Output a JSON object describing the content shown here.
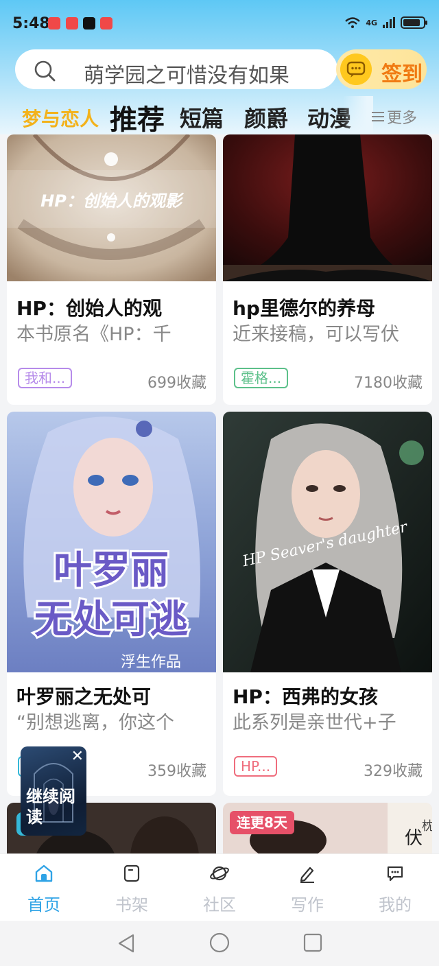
{
  "status": {
    "time": "5:48",
    "network": "4G"
  },
  "search": {
    "text": "萌学园之可惜没有如果"
  },
  "signin": {
    "label": "签到"
  },
  "tabs": [
    "梦与恋人",
    "推荐",
    "短篇",
    "颜爵",
    "动漫"
  ],
  "more_label": "更多",
  "cards": [
    {
      "cover_text": "HP：创始人的观影",
      "title": "HP：创始人的观",
      "desc": "本书原名《HP：千",
      "tag": "我和...",
      "tag_color": "#b68bea",
      "count": "699收藏"
    },
    {
      "title": "hp里德尔的养母",
      "desc": "近来接稿，可以写伏",
      "tag": "霍格...",
      "tag_color": "#5cc08a",
      "count": "7180收藏"
    },
    {
      "cover_text_line1": "叶罗丽",
      "cover_text_line2": "无处可逃",
      "cover_signature": "浮生作品",
      "title": "叶罗丽之无处可",
      "desc": "“别想逃离，你这个",
      "tag": "",
      "tag_color": "#35b8d8",
      "count": "359收藏"
    },
    {
      "cover_script": "HP Seaver's daughter",
      "title": "HP：西弗的女孩",
      "desc": "此系列是亲世代+子",
      "tag": "HP...",
      "tag_color": "#ef6d7d",
      "count": "329收藏"
    },
    {
      "badge": ""
    },
    {
      "badge": "连更8天"
    }
  ],
  "continue_reading": {
    "label": "继续阅读"
  },
  "nav": [
    "首页",
    "书架",
    "社区",
    "写作",
    "我的"
  ],
  "colors": {
    "accent": "#2fa3e6",
    "signin": "#f07a12",
    "tab_highlight": "#f3b21b"
  }
}
